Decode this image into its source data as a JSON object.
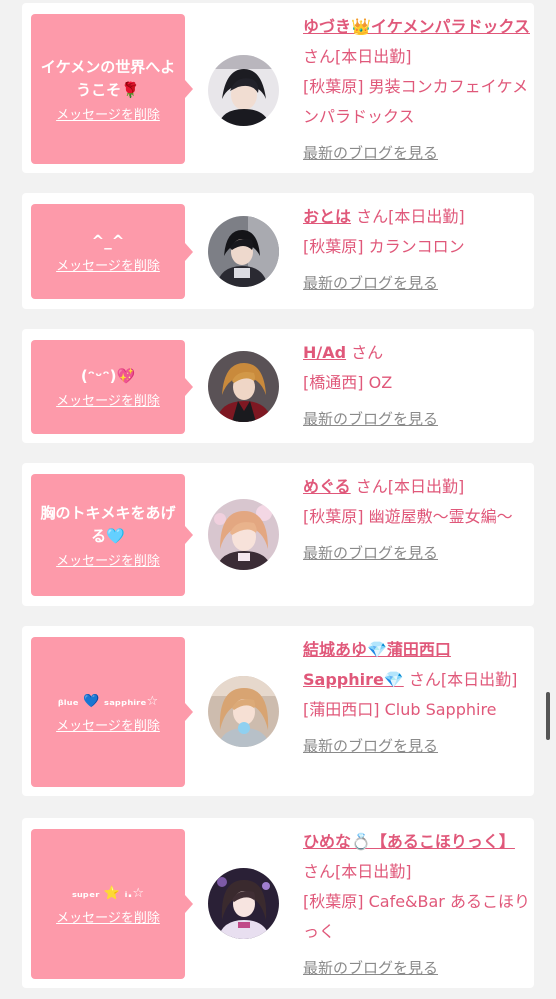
{
  "delete_label": "メッセージを削除",
  "blog_label": "最新のブログを見る",
  "colors": {
    "accent": "#e0587a",
    "bubble": "#fd9aaa",
    "background": "#f2f2f2",
    "card": "#ffffff",
    "link_gray": "#8a8a8a"
  },
  "cards": [
    {
      "message": "イケメンの世界へようこそ🌹",
      "name": "ゆづき👑イケメンパラドックス",
      "san": "さん",
      "status": "[本日出勤]",
      "area": "[秋葉原]",
      "shop": "男装コンカフェイケメンパラドックス"
    },
    {
      "message": "^_^",
      "name": "おとは",
      "san": "さん",
      "status": "[本日出勤]",
      "area": "[秋葉原]",
      "shop": "カランコロン"
    },
    {
      "message": "(ᵔᵕᵔ)💖",
      "name": "H/Ad",
      "san": "さん",
      "status": "",
      "area": "[橋通西]",
      "shop": "OZ"
    },
    {
      "message": "胸のトキメキをあげる🩵",
      "name": "めぐる",
      "san": "さん",
      "status": "[本日出勤]",
      "area": "[秋葉原]",
      "shop": "幽遊屋敷〜霊女編〜"
    },
    {
      "message": "ᵦₗᵤₑ 💙 ₛₐₚₚₕᵢᵣₑ☆",
      "name": "結城あゆ💎蒲田西口Sapphire💎",
      "san": "さん",
      "status": "[本日出勤]",
      "area": "[蒲田西口]",
      "shop": "Club Sapphire"
    },
    {
      "message": "ₛᵤₚₑᵣ ⭐️ ᵢ.☆",
      "name": "ひめな💍【あるこほりっく】",
      "san": "さん",
      "status": "[本日出勤]",
      "area": "[秋葉原]",
      "shop": "Cafe&Bar あるこほりっく"
    }
  ]
}
